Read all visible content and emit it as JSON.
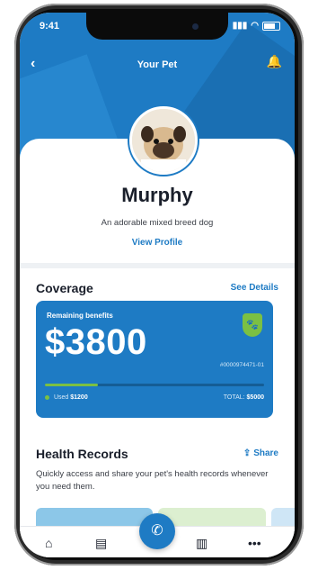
{
  "status_bar": {
    "time": "9:41"
  },
  "nav": {
    "title": "Your Pet",
    "back_icon": "‹",
    "bell_icon": "🔔"
  },
  "pet": {
    "name": "Murphy",
    "description": "An adorable mixed breed dog",
    "view_profile": "View Profile"
  },
  "coverage": {
    "title": "Coverage",
    "see_details": "See Details",
    "remaining_label": "Remaining benefits",
    "amount": "$3800",
    "policy_number": "#0000974471-01",
    "used_label": "Used",
    "used_value": "$1200",
    "total_label": "TOTAL:",
    "total_value": "$5000",
    "progress_fraction": 0.24,
    "colors": {
      "primary": "#1e7bc4",
      "accent": "#7bc043"
    }
  },
  "health_records": {
    "title": "Health Records",
    "share": "Share",
    "description": "Quickly access and share your pet's health records whenever you need them."
  },
  "tabbar": {
    "items": [
      "home-icon",
      "records-icon",
      "chat-icon",
      "trash-icon",
      "more-icon"
    ]
  }
}
